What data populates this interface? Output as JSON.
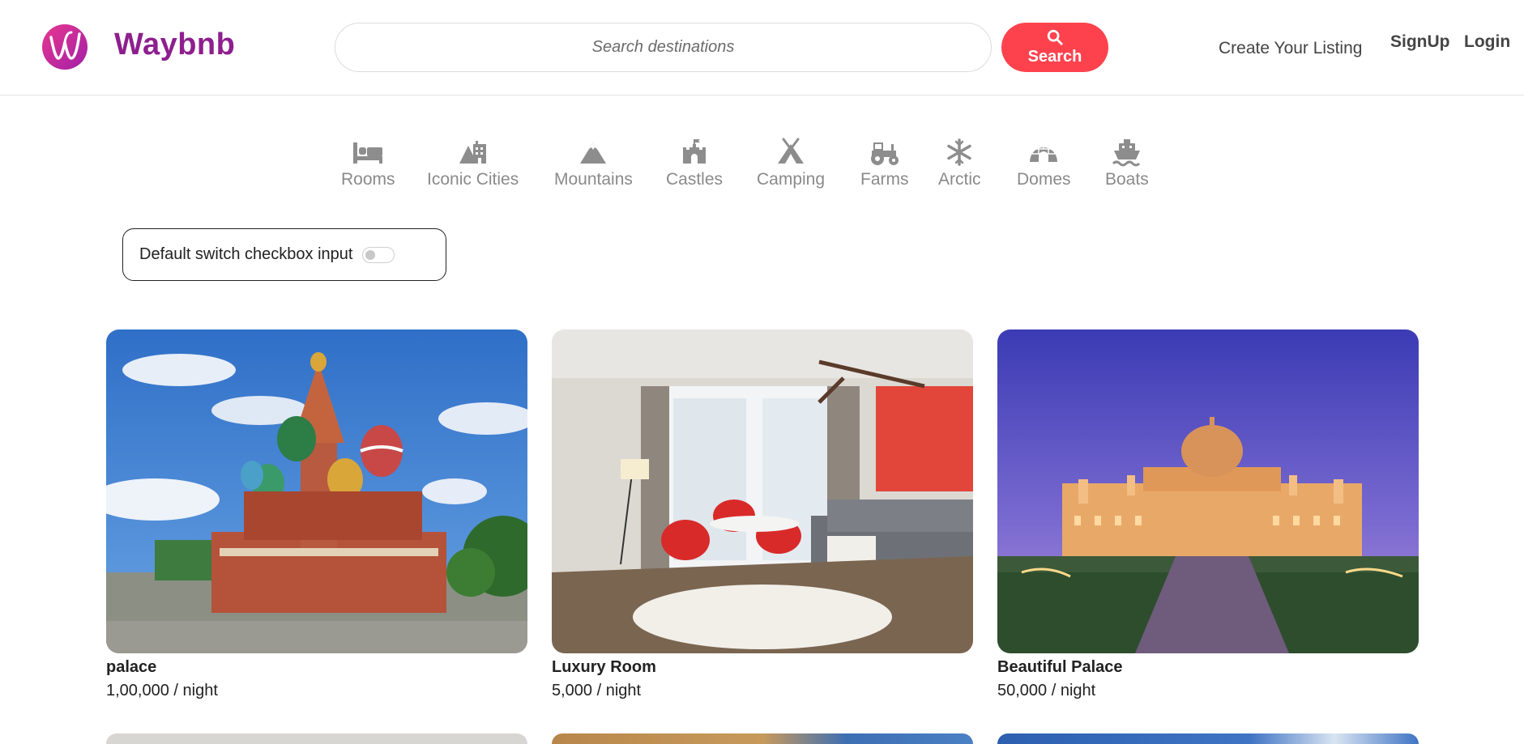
{
  "navbar": {
    "brand": "Waybnb",
    "search_placeholder": "Search destinations",
    "search_button": "Search",
    "create_listing": "Create Your Listing",
    "signup": "SignUp",
    "login": "Login",
    "accent_color": "#fe424d",
    "brand_color": "#8e1f8e"
  },
  "filters": [
    {
      "label": "Rooms",
      "icon": "bed-icon"
    },
    {
      "label": "Iconic Cities",
      "icon": "city-icon"
    },
    {
      "label": "Mountains",
      "icon": "mountain-icon"
    },
    {
      "label": "Castles",
      "icon": "castle-icon"
    },
    {
      "label": "Camping",
      "icon": "campground-icon"
    },
    {
      "label": "Farms",
      "icon": "tractor-icon"
    },
    {
      "label": "Arctic",
      "icon": "snowflake-icon"
    },
    {
      "label": "Domes",
      "icon": "igloo-icon"
    },
    {
      "label": "Boats",
      "icon": "ship-icon"
    }
  ],
  "toggle": {
    "label": "Default switch checkbox input",
    "checked": false
  },
  "listings": [
    {
      "title": "palace",
      "price": "1,00,000 / night"
    },
    {
      "title": "Luxury Room",
      "price": "5,000 / night"
    },
    {
      "title": "Beautiful Palace",
      "price": "50,000 / night"
    }
  ]
}
